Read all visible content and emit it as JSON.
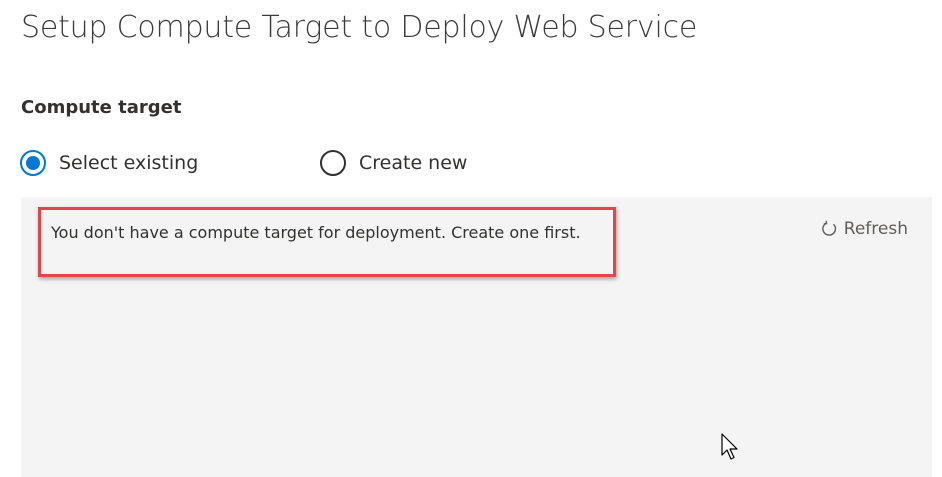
{
  "page": {
    "title": "Setup Compute Target to Deploy Web Service"
  },
  "compute_target": {
    "label": "Compute target",
    "options": [
      {
        "label": "Select existing",
        "selected": true
      },
      {
        "label": "Create new",
        "selected": false
      }
    ]
  },
  "panel": {
    "message": "You don't have a compute target for deployment. Create one first.",
    "refresh_label": "Refresh",
    "refresh_icon": "refresh-icon"
  },
  "colors": {
    "accent": "#0078d4",
    "highlight": "#e0474c",
    "panel_bg": "#f4f4f4"
  }
}
